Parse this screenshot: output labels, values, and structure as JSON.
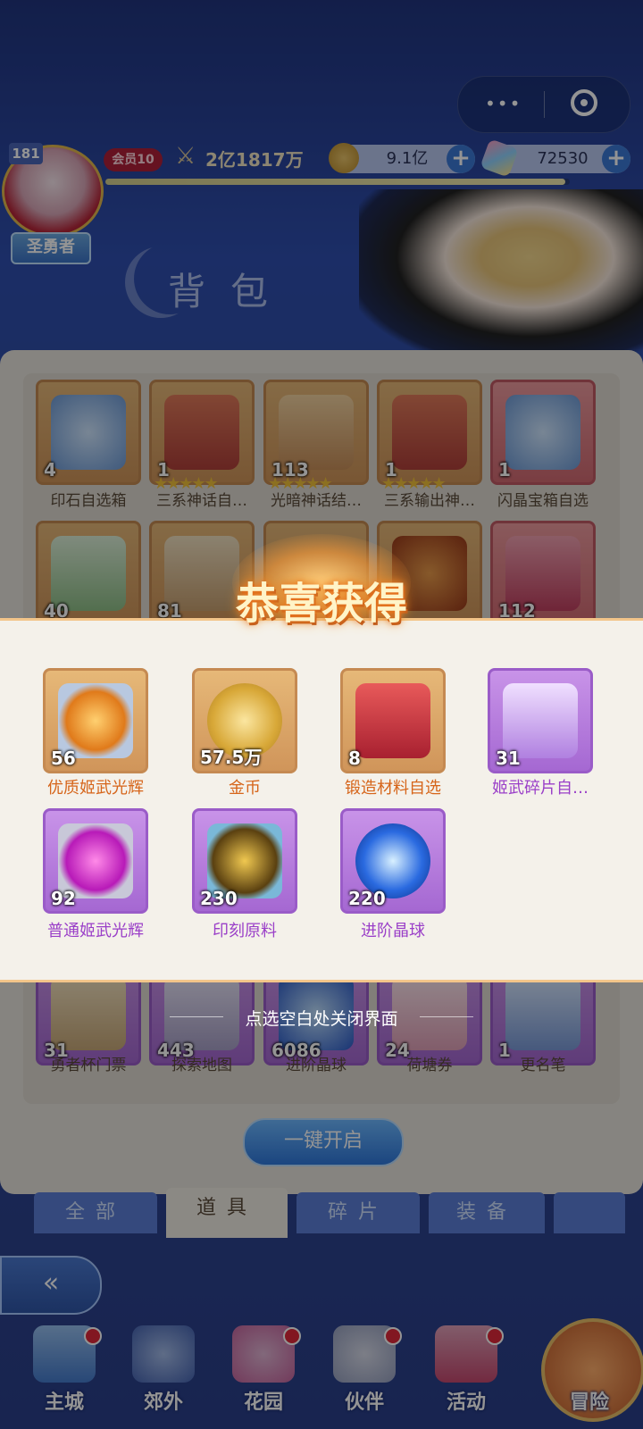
{
  "top_capsule": {
    "more": "•••"
  },
  "player": {
    "level": "181",
    "vip": "会员10",
    "power": "2亿1817万",
    "title": "圣勇者",
    "exp_fraction": 0.99
  },
  "resources": {
    "gold": "9.1亿",
    "gems": "72530"
  },
  "bag": {
    "title": "背包"
  },
  "grid": {
    "row1": [
      {
        "name": "印石自选箱",
        "count": "4"
      },
      {
        "name": "三系神话自…",
        "count": "1"
      },
      {
        "name": "光暗神话结…",
        "count": "113"
      },
      {
        "name": "三系输出神…",
        "count": "1"
      },
      {
        "name": "闪晶宝箱自选",
        "count": "1"
      }
    ],
    "row2_counts": [
      "40",
      "81",
      "112"
    ],
    "row_bottom": [
      {
        "name": "勇者杯门票",
        "count": "31"
      },
      {
        "name": "探索地图",
        "count": "443"
      },
      {
        "name": "进阶晶球",
        "count": "6086"
      },
      {
        "name": "荷塘券",
        "count": "24"
      },
      {
        "name": "更名笔",
        "count": "1"
      }
    ]
  },
  "reward": {
    "title": "恭喜获得",
    "items": [
      {
        "name": "优质姬武光辉",
        "count": "56"
      },
      {
        "name": "金币",
        "count": "57.5万"
      },
      {
        "name": "锻造材料自选",
        "count": "8"
      },
      {
        "name": "姬武碎片自…",
        "count": "31"
      },
      {
        "name": "普通姬武光辉",
        "count": "92"
      },
      {
        "name": "印刻原料",
        "count": "230"
      },
      {
        "name": "进阶晶球",
        "count": "220"
      }
    ],
    "close_hint": "点选空白处关闭界面"
  },
  "onekey": "一键开启",
  "tabs": [
    "全部",
    "道具",
    "碎片",
    "装备"
  ],
  "nav": [
    "主城",
    "郊外",
    "花园",
    "伙伴",
    "活动",
    "冒险"
  ]
}
